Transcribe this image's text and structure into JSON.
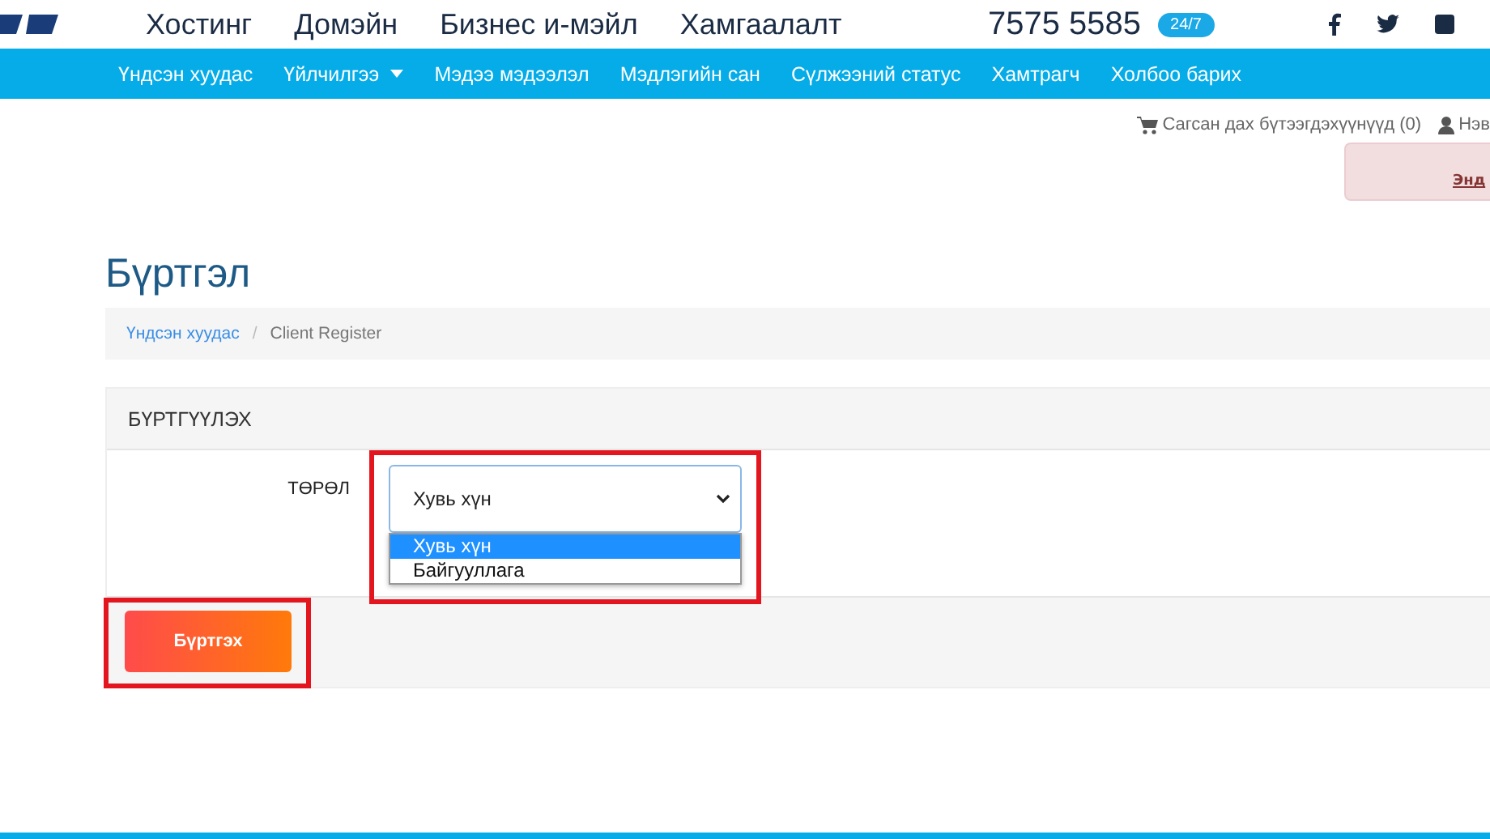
{
  "top_bar": {
    "menu": [
      "Хостинг",
      "Домэйн",
      "Бизнес и-мэйл",
      "Хамгаалалт"
    ],
    "phone": "7575 5585",
    "badge": "24/7"
  },
  "nav": {
    "items": [
      {
        "label": "Үндсэн хуудас",
        "dropdown": false
      },
      {
        "label": "Үйлчилгээ",
        "dropdown": true
      },
      {
        "label": "Мэдээ мэдээлэл",
        "dropdown": false
      },
      {
        "label": "Мэдлэгийн сан",
        "dropdown": false
      },
      {
        "label": "Сүлжээний статус",
        "dropdown": false
      },
      {
        "label": "Хамтрагч",
        "dropdown": false
      },
      {
        "label": "Холбоо барих",
        "dropdown": false
      }
    ]
  },
  "user_bar": {
    "cart": "Сагсан дах бүтээгдэхүүнүүд (0)",
    "account": "Нэв"
  },
  "alert": {
    "link": "Энд"
  },
  "page_title": "Бүртгэл",
  "breadcrumb": {
    "separator": "/",
    "items": [
      {
        "label": "Үндсэн хуудас",
        "link": true
      },
      {
        "label": "Client Register",
        "link": false
      }
    ]
  },
  "form": {
    "heading": "БҮРТГҮҮЛЭХ",
    "field_label": "ТӨРӨЛ",
    "select_value": "Хувь хүн",
    "options": [
      {
        "label": "Хувь хүн",
        "selected": true
      },
      {
        "label": "Байгууллага",
        "selected": false
      }
    ],
    "submit": "Бүртгэх"
  }
}
